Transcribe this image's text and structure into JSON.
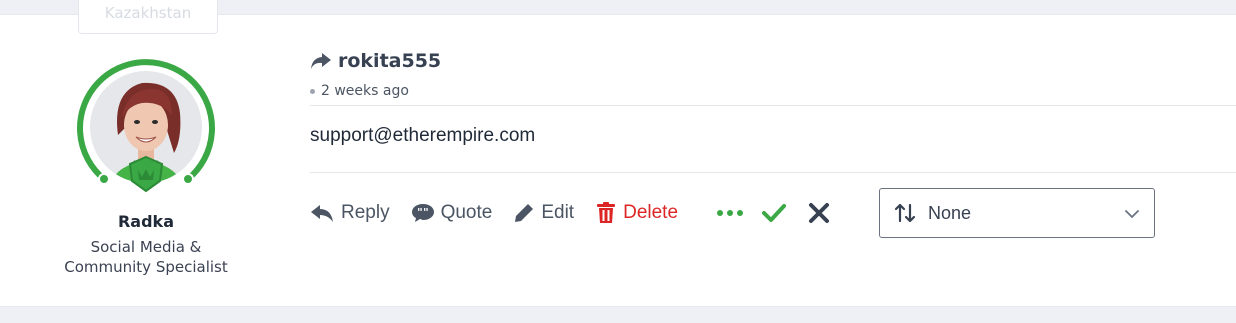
{
  "previous_post": {
    "fragment_text": "Kazakhstan"
  },
  "author": {
    "name": "Radka",
    "role_line1": "Social Media &",
    "role_line2": "Community Specialist",
    "ring_color": "#3aa845",
    "badge_color": "#3aa845"
  },
  "post": {
    "username": "rokita555",
    "time_ago": "2 weeks ago",
    "body": "support@etherempire.com"
  },
  "actions": {
    "reply": "Reply",
    "quote": "Quote",
    "edit": "Edit",
    "delete": "Delete",
    "more_icon": "ellipsis-icon",
    "approve_icon": "check-icon",
    "reject_icon": "x-icon"
  },
  "sort_select": {
    "value": "None",
    "icon": "sort-arrows-icon"
  },
  "colors": {
    "accent_green": "#3aa845",
    "delete_red": "#dc2626",
    "text_gray": "#4b5563"
  }
}
